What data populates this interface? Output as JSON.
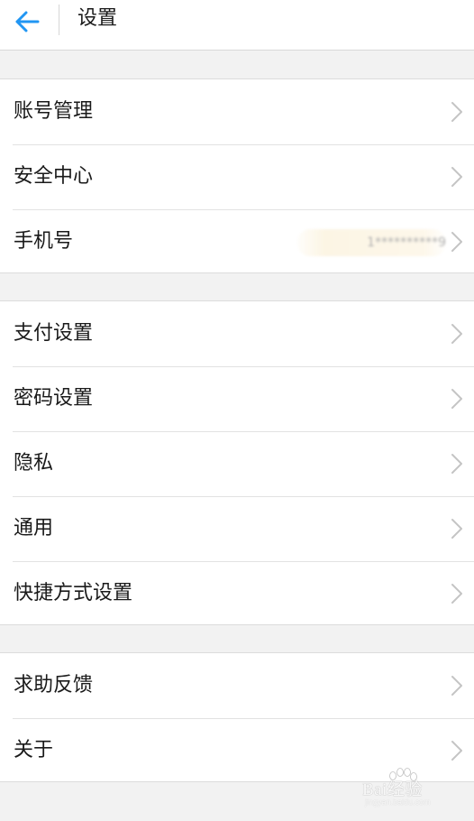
{
  "header": {
    "title": "设置",
    "back_icon": "arrow-left-icon",
    "accent_color": "#2196f3"
  },
  "groups": [
    {
      "items": [
        {
          "label": "账号管理"
        },
        {
          "label": "安全中心"
        },
        {
          "label": "手机号",
          "value": "1**********9"
        }
      ]
    },
    {
      "items": [
        {
          "label": "支付设置"
        },
        {
          "label": "密码设置"
        },
        {
          "label": "隐私"
        },
        {
          "label": "通用"
        },
        {
          "label": "快捷方式设置"
        }
      ]
    },
    {
      "items": [
        {
          "label": "求助反馈"
        },
        {
          "label": "关于"
        }
      ]
    }
  ],
  "watermark": {
    "text": "Bai经验",
    "sub": "jingyan.baidu.com"
  }
}
